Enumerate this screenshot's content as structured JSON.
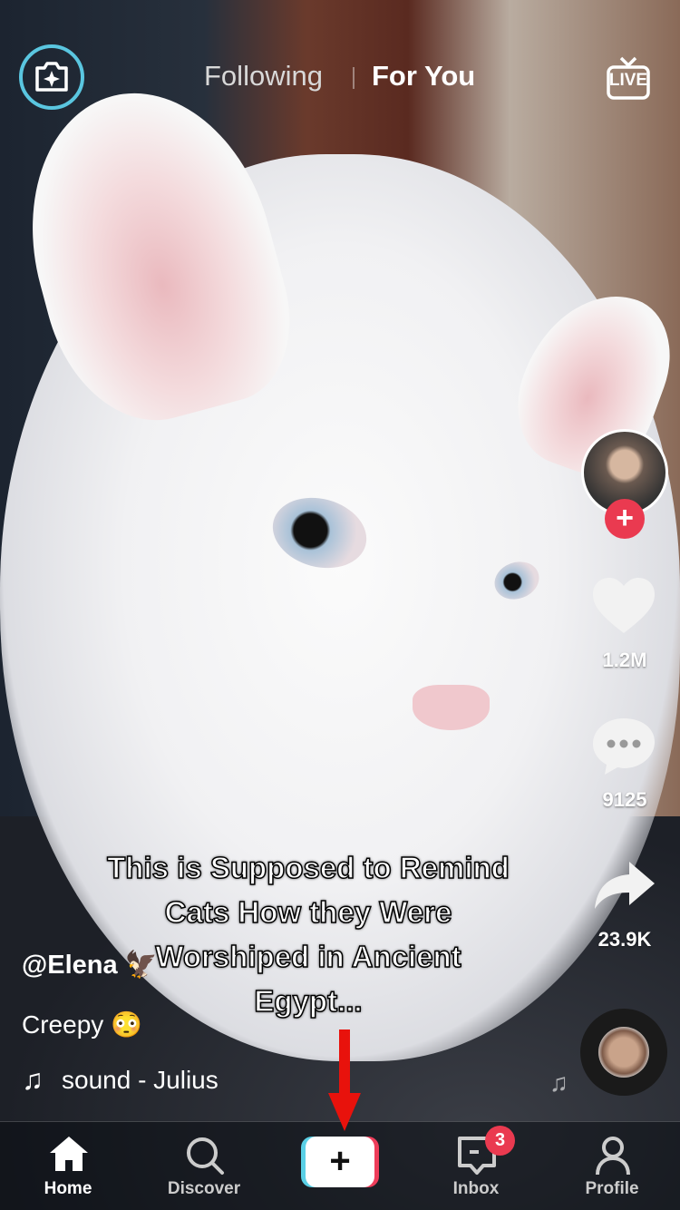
{
  "top": {
    "tabs": [
      {
        "label": "Following",
        "active": false
      },
      {
        "label": "For You",
        "active": true
      }
    ],
    "live_label": "LIVE",
    "camera_icon": "camera-sparkle-icon"
  },
  "side": {
    "likes": "1.2M",
    "comments": "9125",
    "shares": "23.9K"
  },
  "caption": {
    "lines": [
      "This is Supposed to Remind",
      "Cats How they Were",
      "Worshiped in Ancient",
      "Egypt..."
    ]
  },
  "post": {
    "username": "@Elena",
    "username_emoji": "🦅",
    "description": "Creepy",
    "description_emoji": "😳",
    "sound": "sound - Julius"
  },
  "nav": {
    "items": [
      {
        "label": "Home",
        "active": true
      },
      {
        "label": "Discover"
      },
      {
        "label": "Inbox",
        "badge": "3"
      },
      {
        "label": "Profile"
      }
    ]
  },
  "colors": {
    "accent_red": "#ea3a50",
    "camera_ring": "#5ac6e0",
    "annotation_arrow": "#e8120c"
  }
}
